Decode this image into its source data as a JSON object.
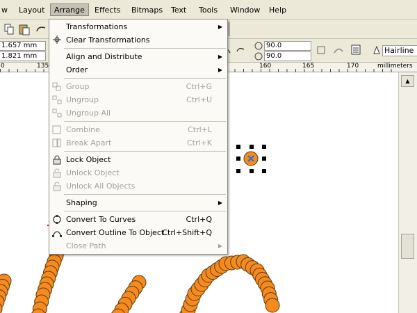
{
  "menubar": {
    "items": [
      "w",
      "Layout",
      "Arrange",
      "Effects",
      "Bitmaps",
      "Text",
      "Tools",
      "Window",
      "Help"
    ]
  },
  "properties": {
    "x_field": "1.657 mm",
    "y_field": "1.821 mm",
    "rotation_a": "90.0",
    "rotation_b": "90.0",
    "outline": "Hairline"
  },
  "ruler": {
    "labels": [
      "0",
      "135",
      "160",
      "165",
      "170",
      "millimeters"
    ]
  },
  "arrange_menu": {
    "transformations": "Transformations",
    "clear_transformations": "Clear Transformations",
    "align_distribute": "Align and Distribute",
    "order": "Order",
    "group": "Group",
    "group_sc": "Ctrl+G",
    "ungroup": "Ungroup",
    "ungroup_sc": "Ctrl+U",
    "ungroup_all": "Ungroup All",
    "combine": "Combine",
    "combine_sc": "Ctrl+L",
    "break_apart": "Break  Apart",
    "break_apart_sc": "Ctrl+K",
    "lock_object": "Lock Object",
    "unlock_object": "Unlock Object",
    "unlock_all": "Unlock All Objects",
    "shaping": "Shaping",
    "convert_curves": "Convert To Curves",
    "convert_curves_sc": "Ctrl+Q",
    "convert_outline": "Convert Outline To Object",
    "convert_outline_sc": "Ctrl+Shift+Q",
    "close_path": "Close Path"
  },
  "colors": {
    "bead_fill": "#f58a1f",
    "bead_stroke": "#5a3a10",
    "underline": "#e01010",
    "selection_x": "#2a6fd6"
  }
}
